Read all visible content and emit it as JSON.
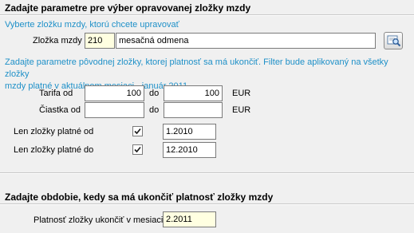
{
  "section1": {
    "title": "Zadajte parametre pre výber opravovanej zložky mzdy",
    "hint": "Vyberte zložku mzdy, ktorú chcete upravovať",
    "component_label": "Zložka mzdy",
    "component_code": "210",
    "component_name": "mesačná odmena",
    "lookup_icon": "search-icon",
    "filter_hint_line1": "Zadajte parametre pôvodnej zložky, ktorej platnosť sa má ukončiť. Filter bude aplikovaný na všetky zložky",
    "filter_hint_line2": "mzdy platné v aktuálnom mesiaci - január  2011.",
    "tarifa_label": "Tarifa od",
    "tarifa_from": "100",
    "tarifa_do_label": "do",
    "tarifa_to": "100",
    "tarifa_unit": "EUR",
    "ciastka_label": "Čiastka od",
    "ciastka_from": "",
    "ciastka_do_label": "do",
    "ciastka_to": "",
    "ciastka_unit": "EUR",
    "valid_from_label": "Len zložky platné od",
    "valid_from_checked": true,
    "valid_from_value": "1.2010",
    "valid_to_label": "Len zložky platné do",
    "valid_to_checked": true,
    "valid_to_value": "12.2010"
  },
  "section2": {
    "title": "Zadajte obdobie, kedy sa má ukončiť platnosť zložky mzdy",
    "end_label": "Platnosť zložky ukončiť v mesiaci",
    "end_value": "2.2011"
  },
  "colors": {
    "hint_blue": "#1e90c8",
    "yellow_field": "#ffffe1",
    "background": "#f0f0f0"
  }
}
